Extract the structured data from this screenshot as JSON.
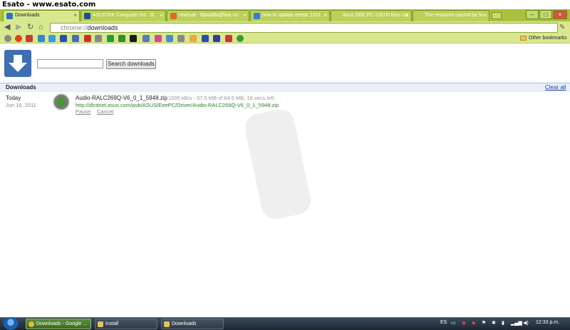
{
  "watermark": "Esato - www.esato.com",
  "tabs": [
    {
      "label": "Downloads",
      "active": true,
      "color": "#2c6fc4"
    },
    {
      "label": "ASUSTeK Computer Inc. -S",
      "active": false,
      "color": "#1a4fa0"
    },
    {
      "label": "Hotmail - fdpadilla@live.co",
      "active": false,
      "color": "#e06a1a"
    },
    {
      "label": "how to update eeepc 1201",
      "active": false,
      "color": "#3a7ad8"
    },
    {
      "label": "Asus EEE PC 1201N Bios Up",
      "active": false,
      "color": "#444444"
    },
    {
      "label": "The resource cannot be fo",
      "active": false,
      "color": "#444444"
    }
  ],
  "address": {
    "scheme": "chrome://",
    "path": "downloads"
  },
  "bookmarks": {
    "other_label": "Other bookmarks"
  },
  "search": {
    "button_label": "Search downloads",
    "value": ""
  },
  "section": {
    "title": "Downloads",
    "clear_label": "Clear all"
  },
  "entry": {
    "day": "Today",
    "date": "Jun 16, 2011",
    "filename": "Audio-RALC269Q-V6_0_1_5948.zip",
    "progress": "1695 kB/s - 37.5 MB of 64.5 MB, 16 secs left",
    "url": "http://dlcdnet.asus.com/pub/ASUS/EeePC/Driver/Audio-RALC269Q-V6_0_1_5948.zip",
    "pause": "Pause",
    "cancel": "Cancel"
  },
  "taskbar": {
    "tasks": [
      "Downloads - Google ...",
      "Install",
      "Downloads"
    ],
    "lang": "ES",
    "clock": "12:33 p.m."
  },
  "colors": {
    "frame": "#a8c23d",
    "toolbar": "#d8e88e",
    "link": "#1a3fb8",
    "url": "#2a8c2a"
  }
}
